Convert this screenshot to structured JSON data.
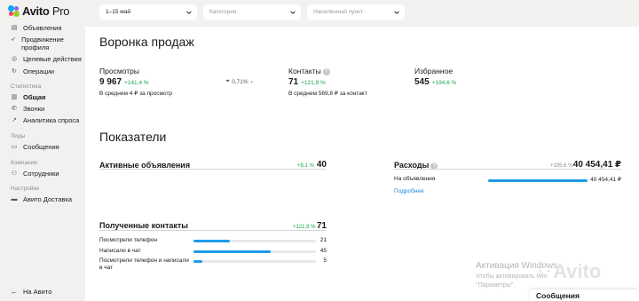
{
  "app": {
    "logo_name": "Avito",
    "logo_suffix": "Pro"
  },
  "sidebar": {
    "items": [
      {
        "label": "Объявления",
        "icon": "list-icon"
      },
      {
        "label": "Продвижение профиля",
        "icon": "rocket-icon"
      },
      {
        "label": "Целевые действия",
        "icon": "target-icon"
      },
      {
        "label": "Операции",
        "icon": "refresh-icon"
      }
    ],
    "stats_section": "Статистика",
    "stats_items": [
      {
        "label": "Общая",
        "icon": "chart-icon",
        "active": true
      },
      {
        "label": "Звонки",
        "icon": "phone-icon"
      },
      {
        "label": "Аналитика спроса",
        "icon": "trend-icon"
      }
    ],
    "leads_section": "Лиды",
    "leads_items": [
      {
        "label": "Сообщения",
        "icon": "message-icon"
      }
    ],
    "company_section": "Компания",
    "company_items": [
      {
        "label": "Сотрудники",
        "icon": "users-icon"
      }
    ],
    "settings_section": "Настройки",
    "settings_items": [
      {
        "label": "Авито Доставка",
        "icon": "truck-icon"
      }
    ],
    "back_label": "На Авито"
  },
  "filters": {
    "period": "1–15 май",
    "category_placeholder": "Категория",
    "location_placeholder": "Населённый пункт"
  },
  "funnel": {
    "title": "Воронка продаж",
    "views": {
      "label": "Просмотры",
      "value": "9 967",
      "delta": "+141,4 %",
      "sub": "В среднем 4 ₽ за просмотр"
    },
    "conversion": "0,71%",
    "contacts": {
      "label": "Контакты",
      "value": "71",
      "delta": "+121,9 %",
      "sub": "В среднем 569,8 ₽ за контакт"
    },
    "favorites": {
      "label": "Избранное",
      "value": "545",
      "delta": "+194,6 %"
    }
  },
  "indicators": {
    "title": "Показатели",
    "active_ads": {
      "label": "Активные объявления",
      "delta": "+8,1 %",
      "value": "40"
    },
    "expenses": {
      "label": "Расходы",
      "delta": "+105,6 %",
      "value": "40 454,41 ₽",
      "rows": [
        {
          "label": "На объявления",
          "value": "40 454,41 ₽",
          "fraction": 1.0
        }
      ],
      "more_link": "Подробнее"
    },
    "contacts": {
      "label": "Полученные контакты",
      "delta": "+121,9 %",
      "value": "71",
      "rows": [
        {
          "label": "Посмотрели телефон",
          "value": "21",
          "fraction": 0.3
        },
        {
          "label": "Написали в чат",
          "value": "45",
          "fraction": 0.63
        },
        {
          "label": "Посмотрели телефон и написали в чат",
          "value": "5",
          "fraction": 0.07
        }
      ]
    }
  },
  "overlay": {
    "activation_title": "Активация Windows",
    "activation_line1": "Чтобы активировать Win",
    "activation_line2": "\"Параметры\".",
    "watermark": "Avito"
  },
  "messages_widget": {
    "label": "Сообщения"
  },
  "colors": {
    "accent": "#1f9be8",
    "positive": "#16a34a",
    "link": "#1b8bdc"
  }
}
